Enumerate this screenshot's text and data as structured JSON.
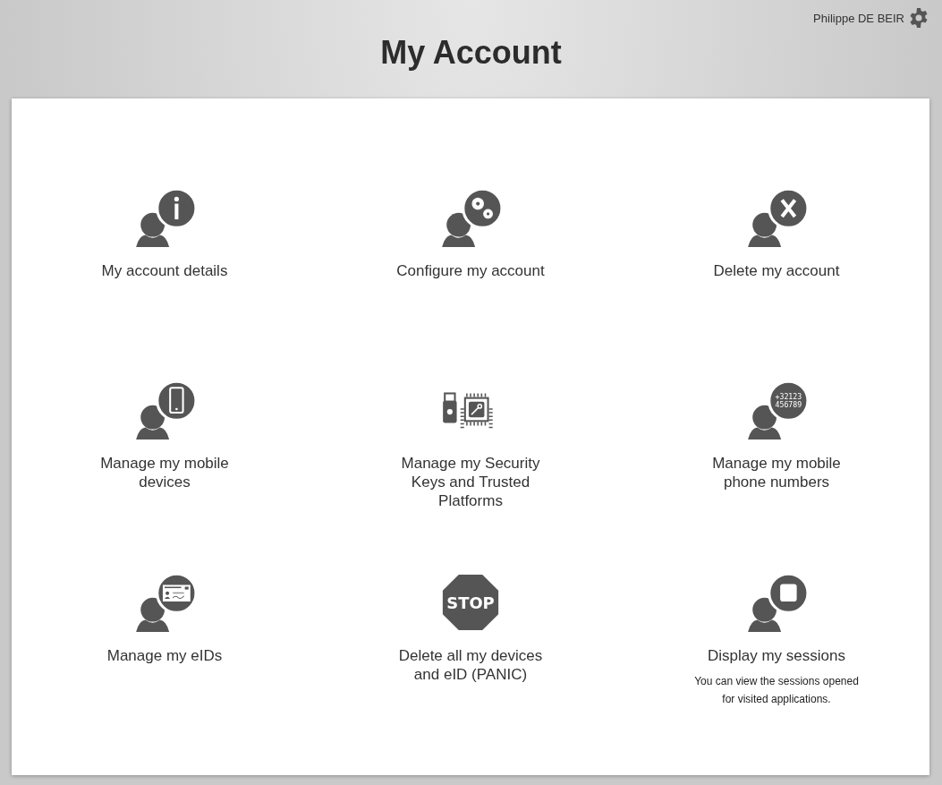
{
  "user": {
    "name": "Philippe DE BEIR"
  },
  "title": "My Account",
  "tiles": [
    {
      "kind": "info",
      "label": "My account details"
    },
    {
      "kind": "gears",
      "label": "Configure my account"
    },
    {
      "kind": "delete",
      "label": "Delete my account"
    },
    {
      "kind": "mobile",
      "label": "Manage my mobile devices"
    },
    {
      "kind": "keys",
      "label": "Manage my Security Keys and Trusted Platforms"
    },
    {
      "kind": "phone",
      "label": "Manage my mobile phone numbers",
      "icon_text": [
        "+32123",
        "456789"
      ]
    },
    {
      "kind": "eid",
      "label": "Manage my eIDs"
    },
    {
      "kind": "stop",
      "label": "Delete all my devices and eID (PANIC)",
      "icon_text": [
        "STOP"
      ]
    },
    {
      "kind": "session",
      "label": "Display my sessions",
      "description": "You can view the sessions opened for visited applications."
    }
  ]
}
